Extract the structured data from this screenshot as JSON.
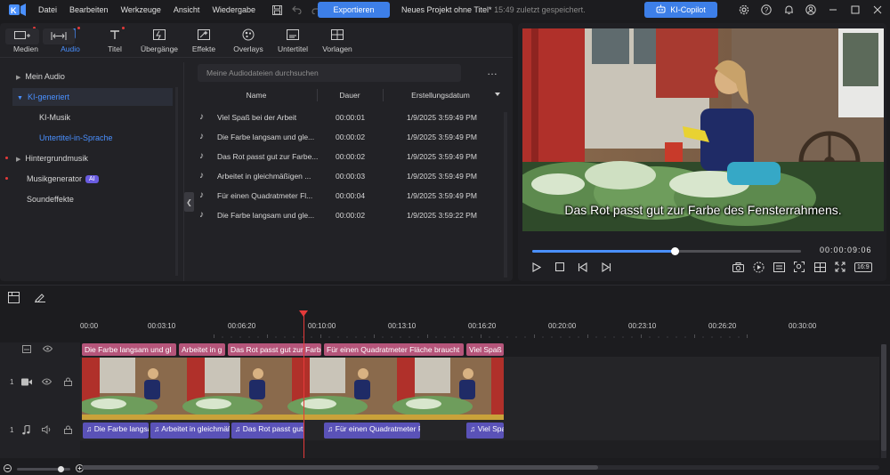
{
  "menu": [
    "Datei",
    "Bearbeiten",
    "Werkzeuge",
    "Ansicht",
    "Wiedergabe"
  ],
  "export_label": "Exportieren",
  "project": {
    "name": "Neues Projekt ohne Titel*",
    "saved": "15:49 zuletzt gespeichert."
  },
  "copilot_label": "KI-Copilot",
  "tabs": [
    {
      "label": "Medien",
      "icon": "media-icon",
      "dot": true
    },
    {
      "label": "Audio",
      "icon": "music-note-icon",
      "dot": true
    },
    {
      "label": "Titel",
      "icon": "title-t-icon",
      "dot": true
    },
    {
      "label": "Übergänge",
      "icon": "transition-icon",
      "dot": false
    },
    {
      "label": "Effekte",
      "icon": "effects-icon",
      "dot": false
    },
    {
      "label": "Overlays",
      "icon": "overlays-icon",
      "dot": false
    },
    {
      "label": "Untertitel",
      "icon": "subtitle-icon",
      "dot": false
    },
    {
      "label": "Vorlagen",
      "icon": "templates-icon",
      "dot": false
    }
  ],
  "tree": {
    "mein_audio": "Mein Audio",
    "ki_generiert": "KI-generiert",
    "ki_musik": "KI-Musik",
    "untertitel_sprache": "Untertitel-in-Sprache",
    "hintergrundmusik": "Hintergrundmusik",
    "musikgenerator": "Musikgenerator",
    "ai_badge": "AI",
    "soundeffekte": "Soundeffekte"
  },
  "search_placeholder": "Meine Audiodateien durchsuchen",
  "more_label": "…",
  "columns": {
    "name": "Name",
    "duration": "Dauer",
    "created": "Erstellungsdatum"
  },
  "files": [
    {
      "name": "Viel Spaß bei der Arbeit",
      "duration": "00:00:01",
      "created": "1/9/2025 3:59:49 PM"
    },
    {
      "name": "Die Farbe langsam und gle...",
      "duration": "00:00:02",
      "created": "1/9/2025 3:59:49 PM"
    },
    {
      "name": "Das Rot passt gut zur Farbe...",
      "duration": "00:00:02",
      "created": "1/9/2025 3:59:49 PM"
    },
    {
      "name": "Arbeitet in gleichmäßigen ...",
      "duration": "00:00:03",
      "created": "1/9/2025 3:59:49 PM"
    },
    {
      "name": " Für einen Quadratmeter Fl...",
      "duration": "00:00:04",
      "created": "1/9/2025 3:59:49 PM"
    },
    {
      "name": "Die Farbe langsam und gle...",
      "duration": "00:00:02",
      "created": "1/9/2025 3:59:22 PM"
    }
  ],
  "preview": {
    "subtitle": "Das Rot passt gut zur Farbe des Fensterrahmens.",
    "timecode": "00:00:09:06",
    "progress_fraction": 0.53,
    "ratio_label": "16:9"
  },
  "ruler_ticks": [
    "00:00",
    "00:03:10",
    "00:06:20",
    "00:10:00",
    "00:13:10",
    "00:16:20",
    "00:20:00",
    "00:23:10",
    "00:26:20",
    "00:30:00"
  ],
  "subtitle_clips": [
    {
      "label": "Die Farbe langsam und gl"
    },
    {
      "label": "Arbeitet in g"
    },
    {
      "label": "Das Rot passt gut zur Farb"
    },
    {
      "label": "Für einen Quadratmeter Fläche braucht"
    },
    {
      "label": "Viel Spaß"
    }
  ],
  "audio_clips": [
    {
      "label": "Die Farbe langsa"
    },
    {
      "label": "Arbeitet in gleichmäßi"
    },
    {
      "label": "Das Rot passt gut"
    },
    {
      "label": "Für einen Quadratmeter F"
    },
    {
      "label": "Viel Spa"
    }
  ],
  "track_numbers": {
    "video": "1",
    "audio": "1"
  },
  "colors": {
    "accent": "#3d7fe8",
    "subtitle_clip": "#b5557a",
    "audio_clip": "#5a52b8",
    "playhead": "#e53a3a"
  }
}
